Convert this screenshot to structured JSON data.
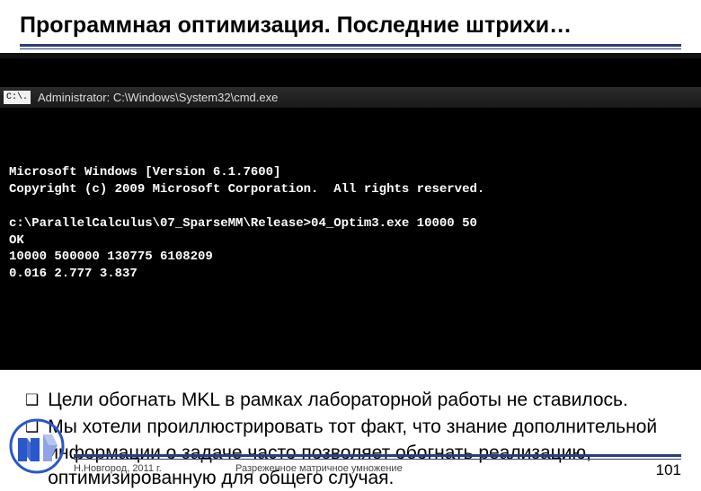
{
  "title": "Программная оптимизация. Последние штрихи…",
  "terminal": {
    "icon": "C:\\.",
    "window_title": "Administrator: C:\\Windows\\System32\\cmd.exe",
    "lines": [
      "Microsoft Windows [Version 6.1.7600]",
      "Copyright (c) 2009 Microsoft Corporation.  All rights reserved.",
      "",
      "c:\\ParallelCalculus\\07_SparseMM\\Release>04_Optim3.exe 10000 50",
      "OK",
      "10000 500000 130775 6108209",
      "0.016 2.777 3.837"
    ]
  },
  "bullets": [
    "Цели обогнать MKL в рамках лабораторной работы не ставилось.",
    "Мы хотели проиллюстрировать тот факт, что знание дополнительной информации о задаче часто позволяет обогнать реализацию, оптимизированную для общего случая."
  ],
  "footer": {
    "location": "Н.Новгород, 2011 г.",
    "subject": "Разреженное матричное умножение",
    "page": "101"
  }
}
